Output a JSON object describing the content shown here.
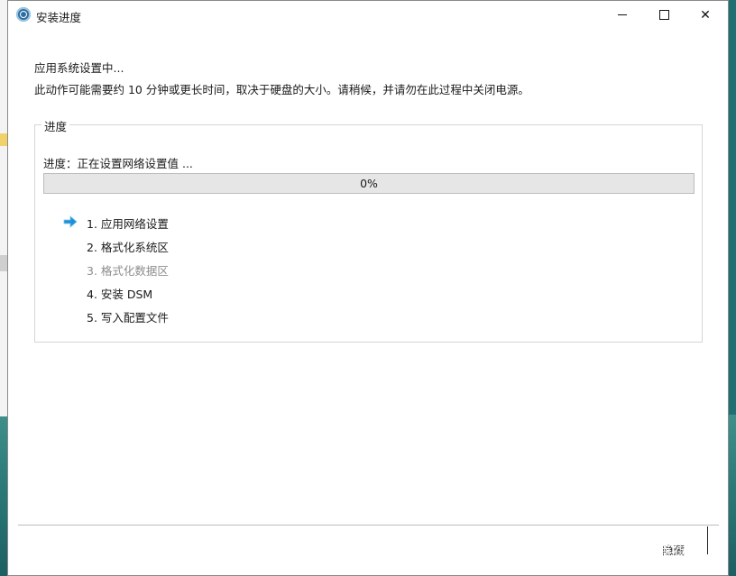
{
  "window": {
    "title": "安装进度",
    "app_icon": "synology-assistant-icon"
  },
  "controls": {
    "minimize": "minimize-icon",
    "maximize": "maximize-icon",
    "close": "close-icon"
  },
  "message": {
    "line1": "应用系统设置中...",
    "line2": "此动作可能需要约 10 分钟或更长时间，取决于硬盘的大小。请稍候，并请勿在此过程中关闭电源。"
  },
  "progress_group": {
    "legend": "进度",
    "status": "进度：正在设置网络设置值 ...",
    "percent_text": "0%",
    "percent_value": 0,
    "steps": [
      {
        "label": "1. 应用网络设置",
        "state": "current"
      },
      {
        "label": "2. 格式化系统区",
        "state": "pending"
      },
      {
        "label": "3. 格式化数据区",
        "state": "disabled"
      },
      {
        "label": "4. 安装 DSM",
        "state": "pending"
      },
      {
        "label": "5. 写入配置文件",
        "state": "pending"
      }
    ]
  },
  "footer": {
    "hide_button": "隐藏"
  },
  "watermark": {
    "text": "什么值得买",
    "logo_glyph": "值"
  },
  "colors": {
    "progress_fill": "#06b025",
    "arrow": "#1e90d8",
    "disabled_text": "#8c8c8c"
  }
}
